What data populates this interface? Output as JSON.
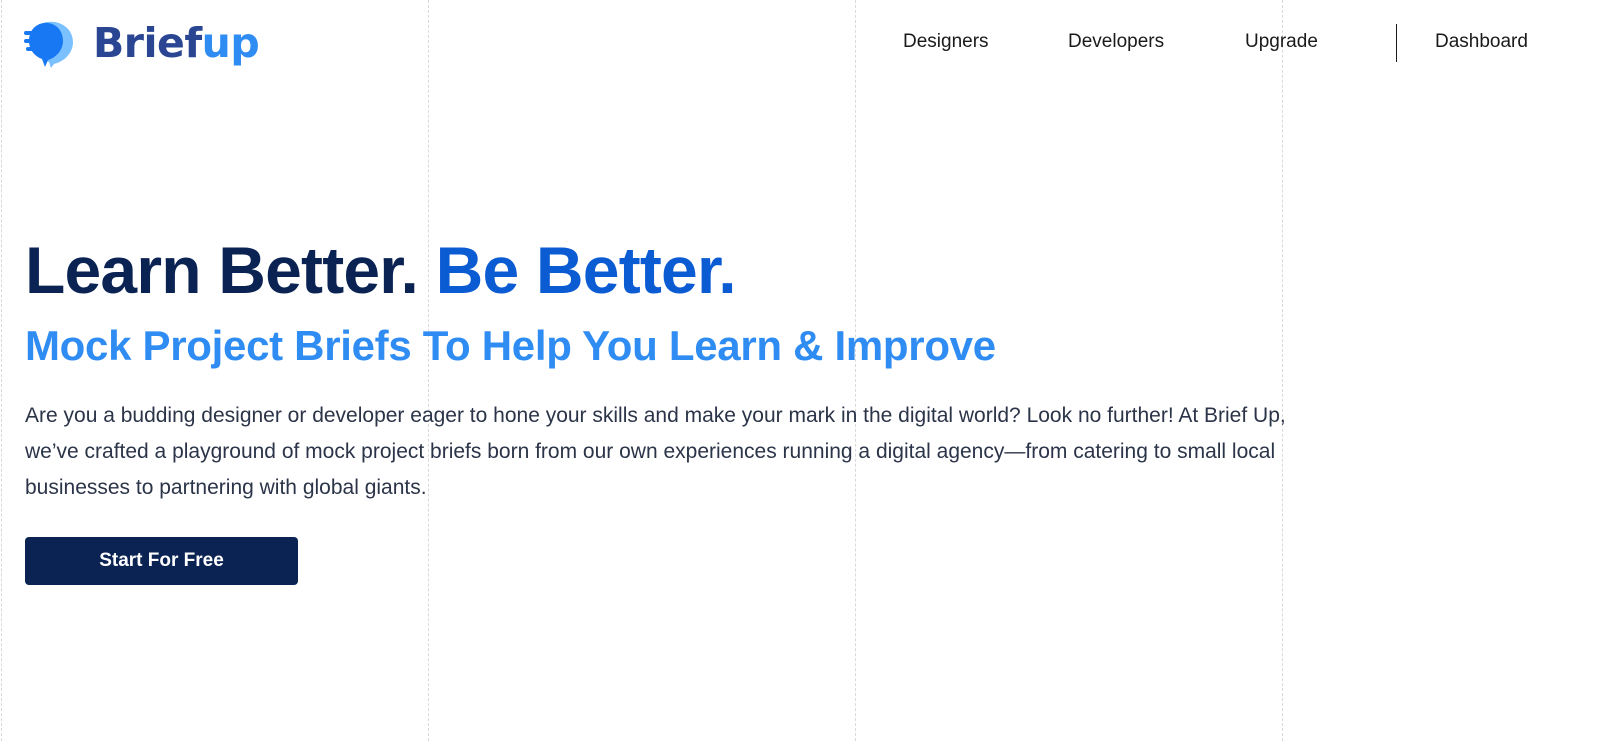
{
  "brand": {
    "name_part1": "Brief",
    "name_part2": "up",
    "icon": "briefup-logo-icon",
    "colors": {
      "dark": "#2a4693",
      "light": "#2f8cf2"
    }
  },
  "nav": {
    "items": [
      {
        "label": "Designers"
      },
      {
        "label": "Developers"
      },
      {
        "label": "Upgrade"
      }
    ],
    "dashboard_label": "Dashboard"
  },
  "hero": {
    "title_part1": "Learn Better.",
    "title_part2": "Be Better.",
    "subtitle": "Mock Project Briefs To Help You Learn & Improve",
    "description": "Are you a budding designer or developer eager to hone your skills and make your mark in the digital world? Look no further! At Brief Up, we’ve crafted a playground of mock project briefs born from our own experiences running a digital agency—from catering to small local businesses to partnering with global giants.",
    "cta_label": "Start For Free"
  },
  "theme": {
    "navy": "#0b2353",
    "royal_blue": "#0b5bd3",
    "light_blue": "#2f8cf2"
  }
}
